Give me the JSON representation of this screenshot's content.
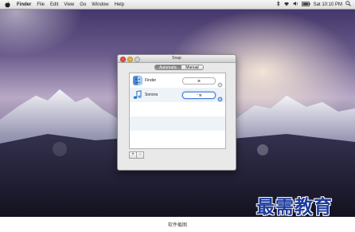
{
  "menubar": {
    "items": [
      "Finder",
      "File",
      "Edit",
      "View",
      "Go",
      "Window",
      "Help"
    ],
    "clock": "Sat 10:10 PM"
  },
  "window": {
    "title": "Snap",
    "tabs": [
      {
        "label": "Automatic",
        "selected": true
      },
      {
        "label": "Manual",
        "selected": false
      }
    ],
    "apps": [
      {
        "name": "Finder",
        "shortcut": "⌘"
      },
      {
        "name": "Sonora",
        "shortcut": "⌃⌘"
      }
    ],
    "add_label": "+",
    "remove_label": "−"
  },
  "watermark": "最需教育",
  "caption": "软件截图"
}
